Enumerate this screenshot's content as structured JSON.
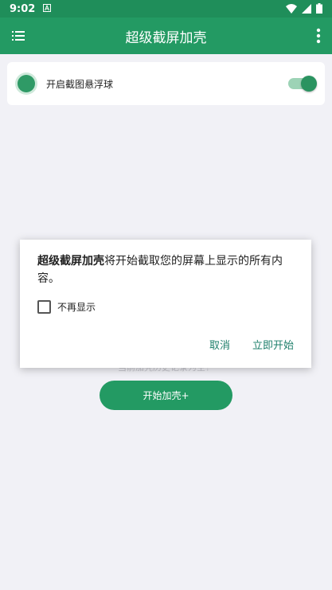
{
  "status": {
    "time": "9:02"
  },
  "appbar": {
    "title": "超级截屏加壳"
  },
  "card": {
    "label": "开启截图悬浮球",
    "toggle_on": true
  },
  "main": {
    "hint": "当前加壳历史记录为空！",
    "button_label": "开始加壳+"
  },
  "dialog": {
    "app_name": "超级截屏加壳",
    "message_rest": "将开始截取您的屏幕上显示的所有内容。",
    "checkbox_label": "不再显示",
    "cancel_label": "取消",
    "confirm_label": "立即开始"
  },
  "colors": {
    "primary": "#239a63",
    "status_bar": "#1f8e5a",
    "dialog_action": "#1e7f6b"
  }
}
